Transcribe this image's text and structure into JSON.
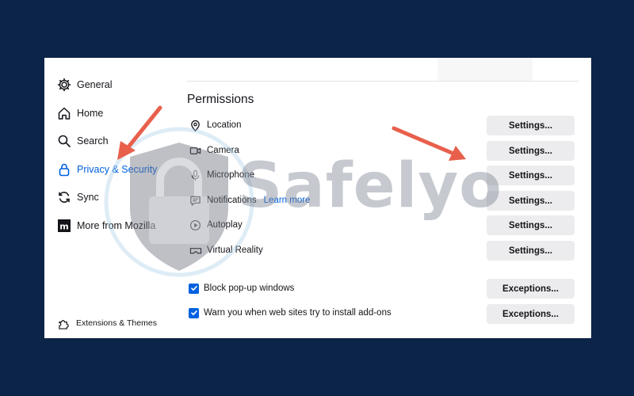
{
  "sidebar": {
    "items": [
      {
        "label": "General",
        "icon": "gear-icon"
      },
      {
        "label": "Home",
        "icon": "home-icon"
      },
      {
        "label": "Search",
        "icon": "search-icon"
      },
      {
        "label": "Privacy & Security",
        "icon": "lock-icon",
        "active": true
      },
      {
        "label": "Sync",
        "icon": "sync-icon"
      },
      {
        "label": "More from Mozilla",
        "icon": "mozilla-icon"
      }
    ],
    "footer": {
      "label": "Extensions & Themes",
      "icon": "puzzle-icon"
    }
  },
  "permissions": {
    "title": "Permissions",
    "rows": [
      {
        "label": "Location",
        "icon": "location-icon",
        "button": "Settings..."
      },
      {
        "label": "Camera",
        "icon": "camera-icon",
        "button": "Settings..."
      },
      {
        "label": "Microphone",
        "icon": "microphone-icon",
        "button": "Settings..."
      },
      {
        "label": "Notifications",
        "icon": "notification-icon",
        "button": "Settings...",
        "link": "Learn more"
      },
      {
        "label": "Autoplay",
        "icon": "autoplay-icon",
        "button": "Settings..."
      },
      {
        "label": "Virtual Reality",
        "icon": "vr-icon",
        "button": "Settings..."
      }
    ],
    "checks": [
      {
        "label": "Block pop-up windows",
        "checked": true,
        "button": "Exceptions..."
      },
      {
        "label": "Warn you when web sites try to install add-ons",
        "checked": true,
        "button": "Exceptions..."
      }
    ]
  },
  "watermark": {
    "text": "Safelyo"
  },
  "colors": {
    "background": "#0c2448",
    "accent": "#0061e0",
    "arrow": "#e8604c"
  }
}
